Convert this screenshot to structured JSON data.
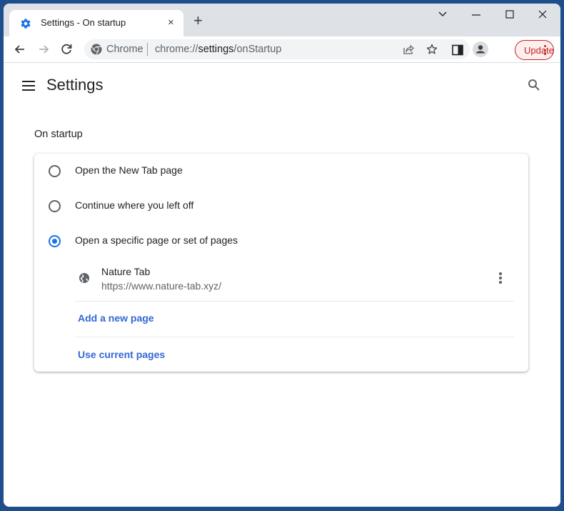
{
  "browser": {
    "tab": {
      "title": "Settings - On startup",
      "icon": "gear-icon",
      "close_label": "×"
    },
    "new_tab_label": "+",
    "window_controls": {
      "tab_search": "⌄",
      "minimize": "—",
      "maximize": "☐",
      "close": "✕"
    },
    "omnibox": {
      "scheme_label": "Chrome",
      "url_prefix": "chrome://",
      "url_host": "settings",
      "url_path": "/onStartup"
    },
    "update_button": {
      "label": "Update"
    }
  },
  "settings": {
    "title": "Settings",
    "section_title": "On startup",
    "options": [
      {
        "label": "Open the New Tab page",
        "checked": false
      },
      {
        "label": "Continue where you left off",
        "checked": false
      },
      {
        "label": "Open a specific page or set of pages",
        "checked": true
      }
    ],
    "startup_pages": [
      {
        "name": "Nature Tab",
        "url": "https://www.nature-tab.xyz/"
      }
    ],
    "add_page_label": "Add a new page",
    "use_current_label": "Use current pages"
  },
  "colors": {
    "accent": "#1a73e8",
    "link": "#3367d6",
    "update": "#c5221f",
    "desktop": "#1f4e8c"
  }
}
